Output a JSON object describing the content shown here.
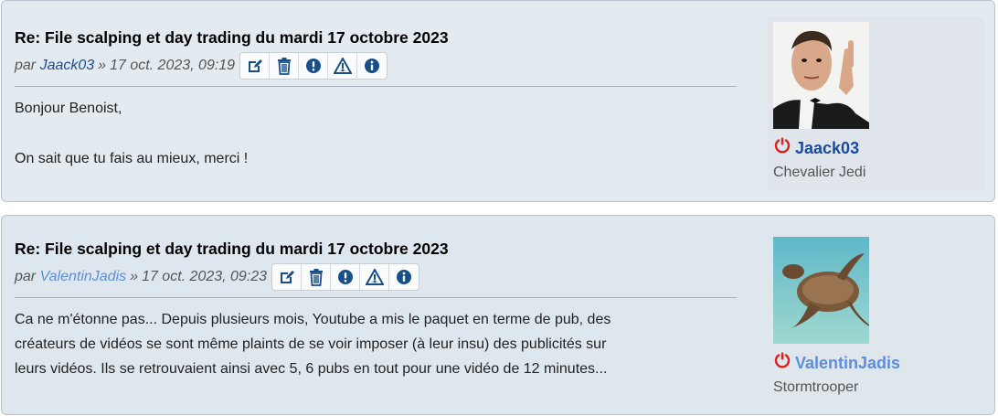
{
  "colors": {
    "tool_icon": "#174f8a",
    "author_blue": "#1a4a9e",
    "author_light": "#5b8ee0",
    "offline_red": "#e0201e"
  },
  "posts": [
    {
      "title": "Re: File scalping et day trading du mardi 17 octobre 2023",
      "by": "par",
      "author": "Jaack03",
      "sep": "»",
      "date": "17 oct. 2023, 09:19",
      "tools": [
        "edit-icon",
        "delete-icon",
        "report-icon",
        "warn-icon",
        "info-icon"
      ],
      "content": [
        "Bonjour Benoist,",
        "On sait que tu fais au mieux, merci !"
      ],
      "profile": {
        "username": "Jaack03",
        "rank": "Chevalier Jedi",
        "status": "offline"
      }
    },
    {
      "title": "Re: File scalping et day trading du mardi 17 octobre 2023",
      "by": "par",
      "author": "ValentinJadis",
      "sep": "»",
      "date": "17 oct. 2023, 09:23",
      "tools": [
        "edit-icon",
        "delete-icon",
        "report-icon",
        "warn-icon",
        "info-icon"
      ],
      "content": [
        "Ca ne m'étonne pas... Depuis plusieurs mois, Youtube a mis le paquet en terme de pub, des",
        "créateurs de vidéos se sont même plaints de se voir imposer (à leur insu) des publicités sur",
        "leurs vidéos. Ils se retrouvaient ainsi avec 5, 6 pubs en tout pour une vidéo de 12 minutes..."
      ],
      "profile": {
        "username": "ValentinJadis",
        "rank": "Stormtrooper",
        "status": "offline"
      }
    }
  ]
}
